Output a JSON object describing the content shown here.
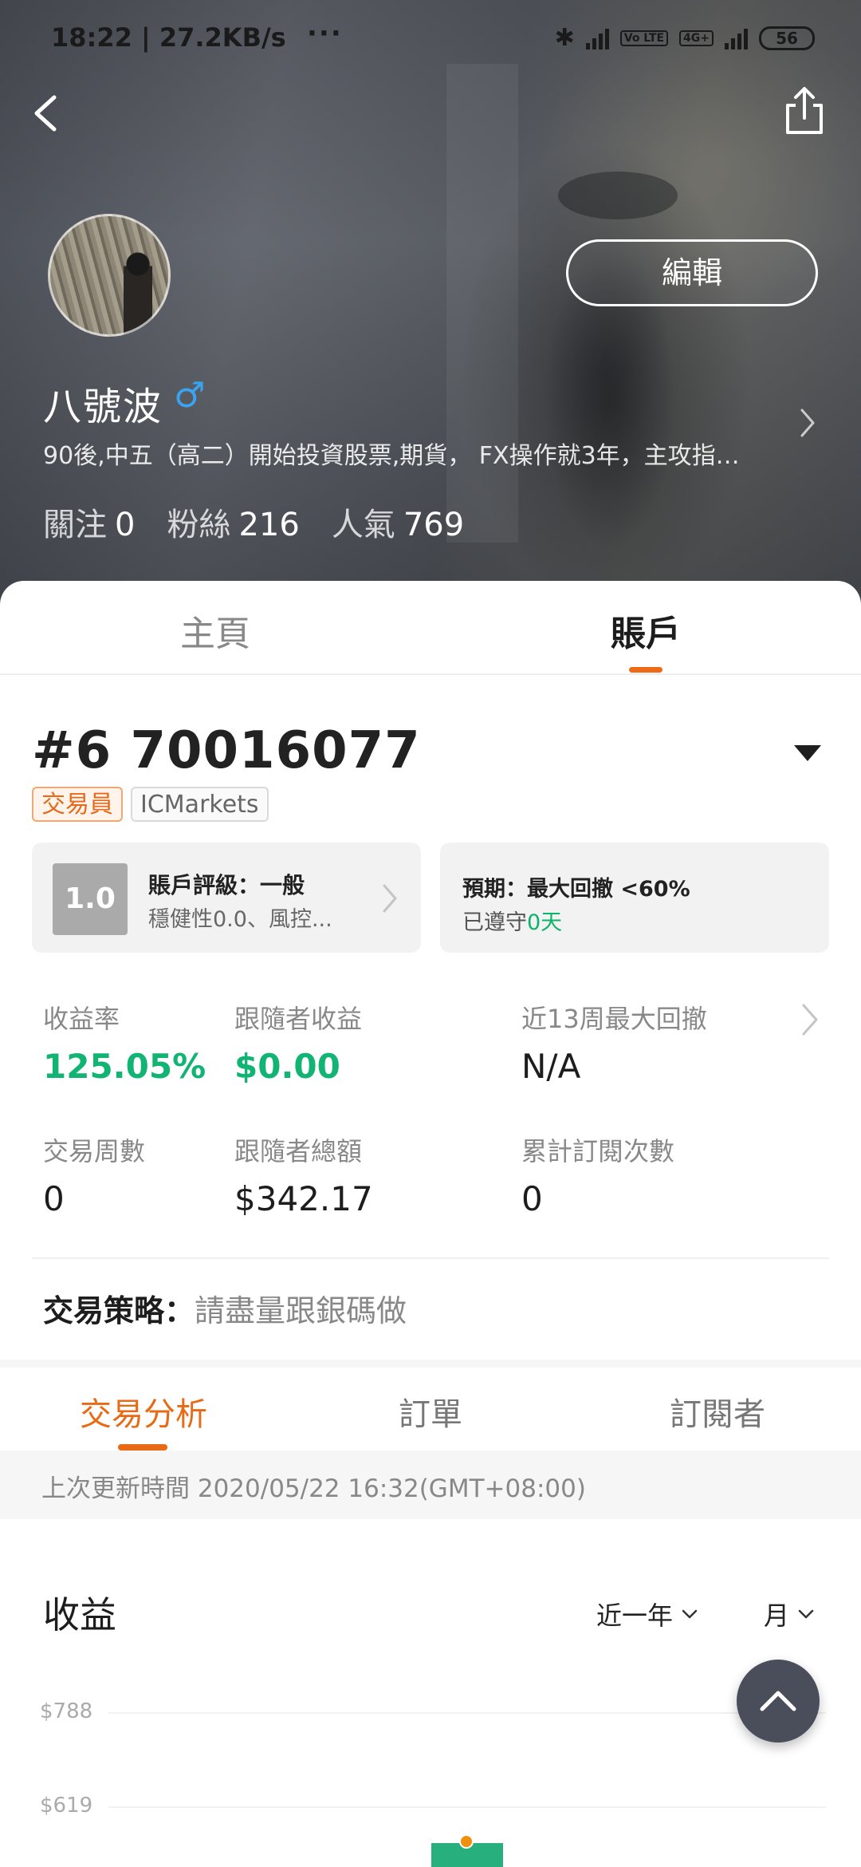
{
  "status_bar": {
    "time": "18:22 | 27.2KB/s",
    "more": "···",
    "battery": "56",
    "volte": "Vo LTE",
    "network": "4G+"
  },
  "profile": {
    "edit_label": "編輯",
    "name": "八號波",
    "gender_symbol": "♂",
    "bio": "90後,中五（高二）開始投資股票,期貨， FX操作就3年，主攻指…",
    "following_label": "關注",
    "following_value": "0",
    "fans_label": "粉絲",
    "fans_value": "216",
    "popularity_label": "人氣",
    "popularity_value": "769"
  },
  "tabs": [
    {
      "label": "主頁",
      "active": false
    },
    {
      "label": "賬戶",
      "active": true
    }
  ],
  "account": {
    "number": "#6 70016077",
    "badges": [
      "交易員",
      "ICMarkets"
    ],
    "rating_score": "1.0",
    "rating_title": "賬戶評級：一般",
    "rating_detail": "穩健性0.0、風控...",
    "expect_title": "預期：最大回撤 <60%",
    "expect_detail_prefix": "已遵守",
    "expect_detail_value": "0天"
  },
  "metrics": [
    {
      "label": "收益率",
      "value": "125.05%",
      "highlight": true
    },
    {
      "label": "跟隨者收益",
      "value": "$0.00",
      "highlight": true
    },
    {
      "label": "近13周最大回撤",
      "value": "N/A",
      "highlight": false
    },
    {
      "label": "交易周數",
      "value": "0",
      "highlight": false
    },
    {
      "label": "跟隨者總額",
      "value": "$342.17",
      "highlight": false
    },
    {
      "label": "累計訂閱次數",
      "value": "0",
      "highlight": false
    }
  ],
  "strategy": {
    "label": "交易策略：",
    "value": "請盡量跟銀碼做"
  },
  "sub_tabs": [
    {
      "label": "交易分析",
      "active": true
    },
    {
      "label": "訂單",
      "active": false
    },
    {
      "label": "訂閱者",
      "active": false
    }
  ],
  "last_updated": "上次更新時間 2020/05/22 16:32(GMT+08:00)",
  "chart_section": {
    "title": "收益",
    "period_label": "近一年",
    "unit_label": "月"
  },
  "chart_data": {
    "type": "bar",
    "title": "收益",
    "y_tick_labels": [
      "$788",
      "$619"
    ],
    "y_ticks": [
      788,
      619
    ],
    "ylim_visible": [
      619,
      788
    ],
    "xlabel": "",
    "ylabel": "",
    "grid": true,
    "bar_color": "#27b07e",
    "marker_color": "#ef8f0d"
  },
  "colors": {
    "accent": "#e86a14",
    "positive": "#12b473",
    "fab": "#4a4d5a"
  },
  "icons": {
    "back": "back-arrow-icon",
    "share": "share-icon",
    "scroll_top": "chevron-up-icon"
  }
}
